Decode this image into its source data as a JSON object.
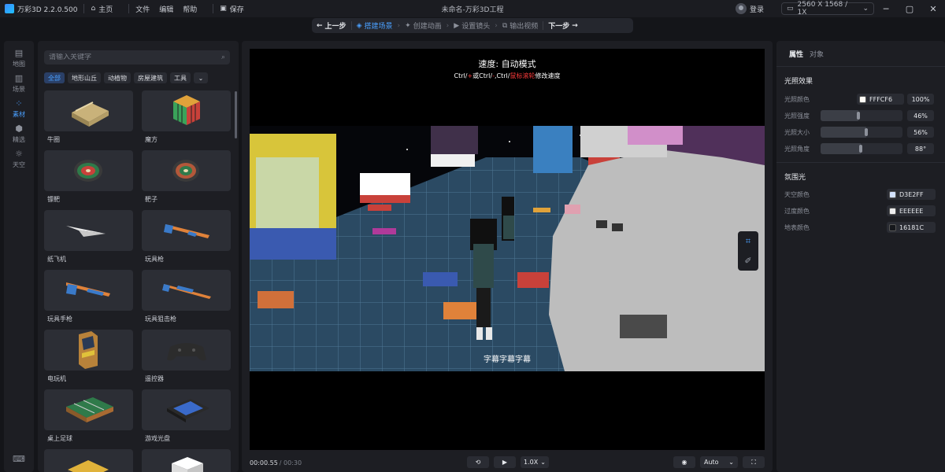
{
  "titlebar": {
    "app_name": "万彩3D 2.2.0.500",
    "menu": [
      "主页",
      "文件",
      "编辑",
      "帮助",
      "保存"
    ],
    "document_title": "未命名-万彩3D工程",
    "login_label": "登录",
    "resolution": "2560 X 1568 / 1X"
  },
  "steps": {
    "prev_label": "上一步",
    "items": [
      "搭建场景",
      "创建动画",
      "设置镜头",
      "输出视频"
    ],
    "active_index": 0,
    "next_label": "下一步"
  },
  "toolstrip": {
    "items": [
      {
        "label": "地图",
        "icon": "map-icon"
      },
      {
        "label": "场景",
        "icon": "scene-icon"
      },
      {
        "label": "素材",
        "icon": "assets-icon"
      },
      {
        "label": "精选",
        "icon": "featured-icon"
      },
      {
        "label": "天空",
        "icon": "sky-icon"
      }
    ],
    "active_index": 2
  },
  "assets": {
    "search_placeholder": "请输入关键字",
    "categories": [
      "全部",
      "地形山丘",
      "动植物",
      "房屋建筑",
      "工具"
    ],
    "active_category": 0,
    "items": [
      "牛圈",
      "魔方",
      "镖靶",
      "靶子",
      "纸飞机",
      "玩具枪",
      "玩具手枪",
      "玩具狙击枪",
      "电玩机",
      "遥控器",
      "桌上足球",
      "游戏光盘"
    ]
  },
  "viewport": {
    "speed_title": "速度: 自动模式",
    "hint_parts": [
      "Ctrl/",
      "+",
      "或Ctrl/",
      "-",
      ",Ctrl/",
      "鼠标滚轮",
      "修改速度"
    ],
    "subtitle": "字幕字幕字幕"
  },
  "playback": {
    "current_time": "00:00.55",
    "total_time": "/ 00:30",
    "speed": "1.0X",
    "quality": "Auto"
  },
  "properties": {
    "tabs": [
      "属性",
      "对象"
    ],
    "active_tab": 0,
    "lighting_title": "光照效果",
    "light_color_label": "光照颜色",
    "light_color_value": "FFFCF6",
    "light_color_opacity": "100%",
    "sliders": [
      {
        "label": "光照强度",
        "value": 0.46,
        "display": "46%"
      },
      {
        "label": "光照大小",
        "value": 0.56,
        "display": "56%"
      },
      {
        "label": "光照角度",
        "value": 0.49,
        "display": "88°"
      }
    ],
    "ambient_title": "氛围光",
    "ambient": [
      {
        "label": "天空颜色",
        "value": "D3E2FF",
        "color": "#D3E2FF"
      },
      {
        "label": "过度颜色",
        "value": "EEEEEE",
        "color": "#EEEEEE"
      },
      {
        "label": "地表颜色",
        "value": "16181C",
        "color": "#16181C"
      }
    ]
  },
  "colors": {
    "accent": "#4aa0ff",
    "light_color": "#FFFCF6"
  }
}
